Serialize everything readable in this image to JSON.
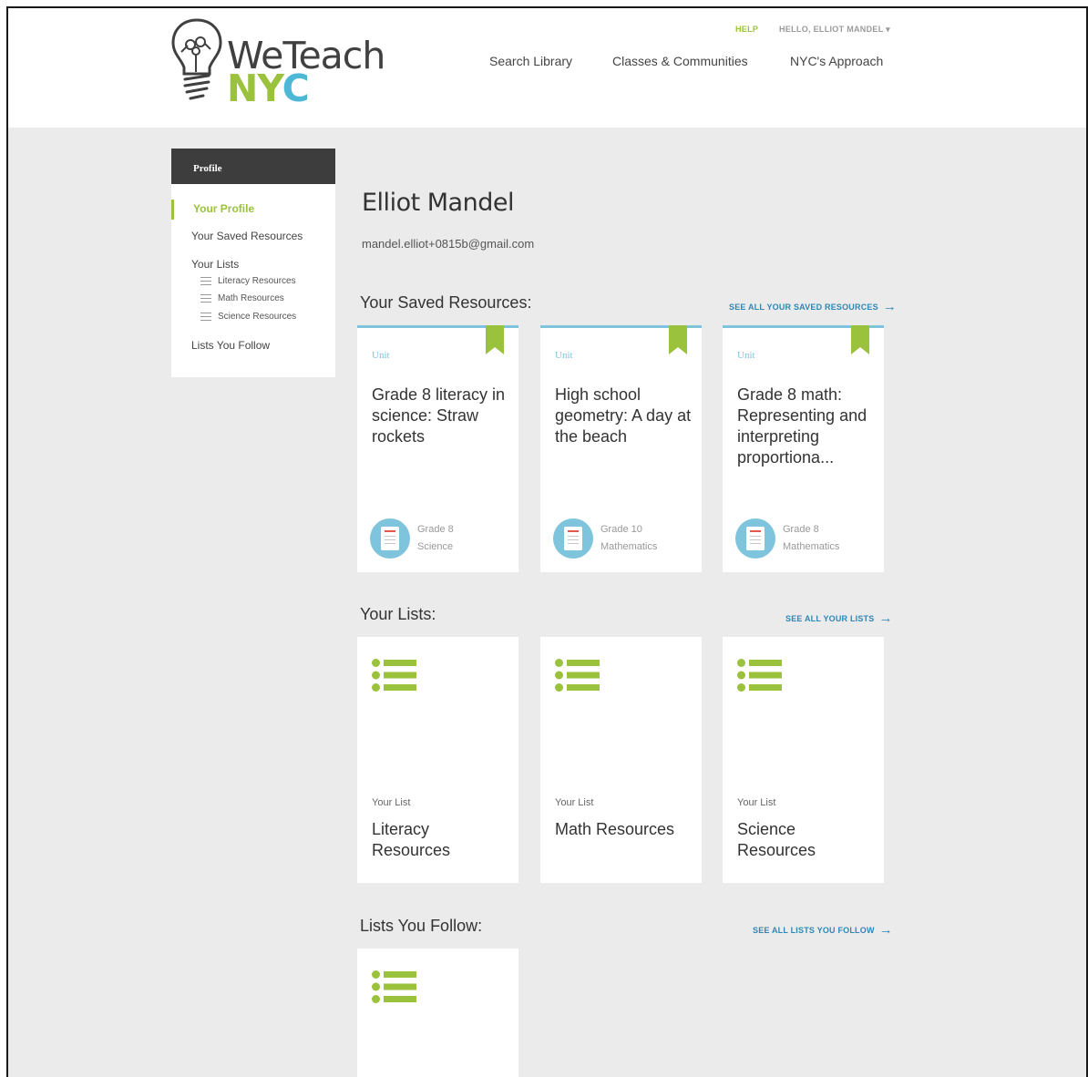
{
  "brand": {
    "word_we": "WeTeach",
    "nyc_n": "N",
    "nyc_y": "Y",
    "nyc_c": "C"
  },
  "topbar": {
    "help": "HELP",
    "user": "HELLO, ELLIOT MANDEL ▾"
  },
  "nav": {
    "search": "Search Library",
    "classes": "Classes & Communities",
    "approach": "NYC's Approach"
  },
  "sidebar": {
    "header": "Profile",
    "your_profile": "Your Profile",
    "saved": "Your Saved Resources",
    "lists": "Your Lists",
    "sub": [
      "Literacy Resources",
      "Math Resources",
      "Science Resources"
    ],
    "follow": "Lists You Follow"
  },
  "profile": {
    "name": "Elliot Mandel",
    "email": "mandel.elliot+0815b@gmail.com"
  },
  "saved": {
    "title": "Your Saved Resources:",
    "see_all": "SEE ALL YOUR SAVED RESOURCES",
    "cards": [
      {
        "type": "Unit",
        "title": "Grade 8 literacy in science: Straw rockets",
        "grade": "Grade 8",
        "subject": "Science"
      },
      {
        "type": "Unit",
        "title": "High school geometry: A day at the beach",
        "grade": "Grade 10",
        "subject": "Mathematics"
      },
      {
        "type": "Unit",
        "title": "Grade 8 math: Representing and interpreting proportiona...",
        "grade": "Grade 8",
        "subject": "Mathematics"
      }
    ]
  },
  "lists": {
    "title": "Your Lists:",
    "see_all": "SEE ALL YOUR LISTS",
    "cards": [
      {
        "label": "Your List",
        "title": "Literacy Resources"
      },
      {
        "label": "Your List",
        "title": "Math Resources"
      },
      {
        "label": "Your List",
        "title": "Science Resources"
      }
    ]
  },
  "follow": {
    "title": "Lists You Follow:",
    "see_all": "SEE ALL LISTS YOU FOLLOW"
  },
  "colors": {
    "green": "#9ac23c",
    "blue": "#7ec4dd",
    "link": "#2e87b5",
    "dark": "#3d3d3d",
    "bg": "#ebebeb"
  }
}
